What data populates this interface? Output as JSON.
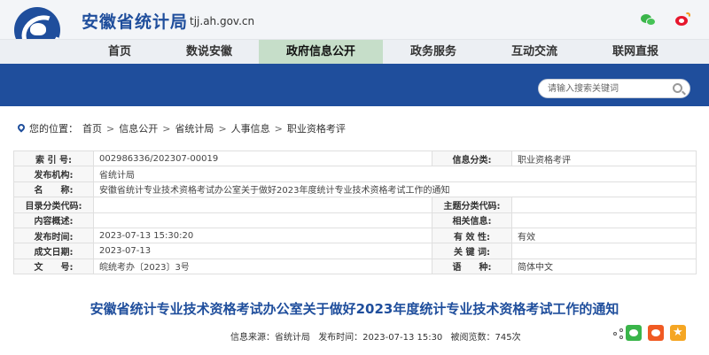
{
  "header": {
    "site_title": "安徽省统计局",
    "domain": "tjj.ah.gov.cn"
  },
  "nav": {
    "items": [
      "首页",
      "数说安徽",
      "政府信息公开",
      "政务服务",
      "互动交流",
      "联网直报"
    ],
    "active": "政府信息公开"
  },
  "search": {
    "placeholder": "请输入搜索关键词"
  },
  "breadcrumb": {
    "prefix": "您的位置：",
    "items": [
      "首页",
      "信息公开",
      "省统计局",
      "人事信息",
      "职业资格考评"
    ],
    "separator": ">"
  },
  "info": {
    "index_label": "索 引 号:",
    "index_value": "002986336/202307-00019",
    "category_label": "信息分类:",
    "category_value": "职业资格考评",
    "publisher_label": "发布机构:",
    "publisher_value": "省统计局",
    "name_label": "名　　称:",
    "name_value": "安徽省统计专业技术资格考试办公室关于做好2023年度统计专业技术资格考试工作的通知",
    "catalog_label": "目录分类代码:",
    "catalog_value": "",
    "topic_label": "主题分类代码:",
    "topic_value": "",
    "summary_label": "内容概述:",
    "summary_value": "",
    "related_label": "相关信息:",
    "related_value": "",
    "pubtime_label": "发布时间:",
    "pubtime_value": "2023-07-13 15:30:20",
    "validity_label": "有 效 性:",
    "validity_value": "有效",
    "formed_label": "成文日期:",
    "formed_value": "2023-07-13",
    "keywords_label": "关 键 词:",
    "keywords_value": "",
    "docno_label": "文　　号:",
    "docno_value": "皖统考办〔2023〕3号",
    "language_label": "语　　种:",
    "language_value": "简体中文"
  },
  "article": {
    "title": "安徽省统计专业技术资格考试办公室关于做好2023年度统计专业技术资格考试工作的通知",
    "source": "信息来源：省统计局",
    "time": "发布时间：2023-07-13 15:30",
    "views": "被阅览数：745次"
  },
  "colors": {
    "brand_blue": "#1f4e9c",
    "nav_active": "#c6dec9",
    "wechat_green": "#3ab54a",
    "weibo_orange": "#f05a23",
    "fav_yellow": "#f5a623"
  }
}
